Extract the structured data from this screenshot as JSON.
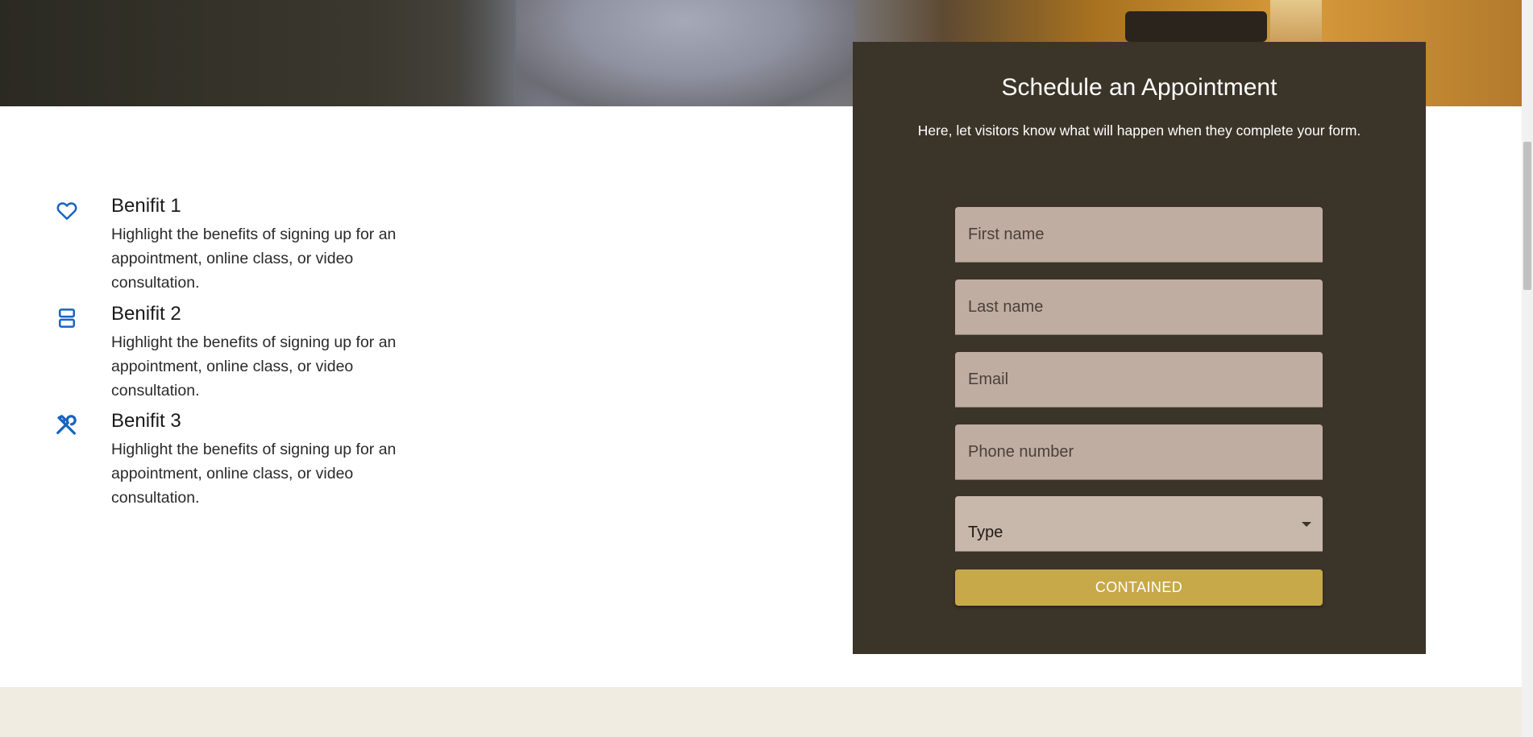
{
  "benefits": [
    {
      "title": "Benifit 1",
      "desc": "Highlight the benefits of signing up for an appointment, online class, or video consultation.",
      "icon": "heart-icon"
    },
    {
      "title": "Benifit 2",
      "desc": "Highlight the benefits of signing up for an appointment, online class, or video consultation.",
      "icon": "stacked-boxes-icon"
    },
    {
      "title": "Benifit 3",
      "desc": "Highlight the benefits of signing up for an appointment, online class, or video consultation.",
      "icon": "tools-icon"
    }
  ],
  "form": {
    "title": "Schedule an Appointment",
    "subtitle": "Here, let visitors know what will happen when they complete your form.",
    "first_name_placeholder": "First name",
    "last_name_placeholder": "Last name",
    "email_placeholder": "Email",
    "phone_placeholder": "Phone number",
    "type_label": "Type",
    "submit_label": "CONTAINED"
  },
  "colors": {
    "panel_bg": "#3b3428",
    "input_bg": "#c0ada2",
    "button_bg": "#c7a949",
    "icon_blue": "#1565c0",
    "footer_bg": "#f1ece2"
  }
}
